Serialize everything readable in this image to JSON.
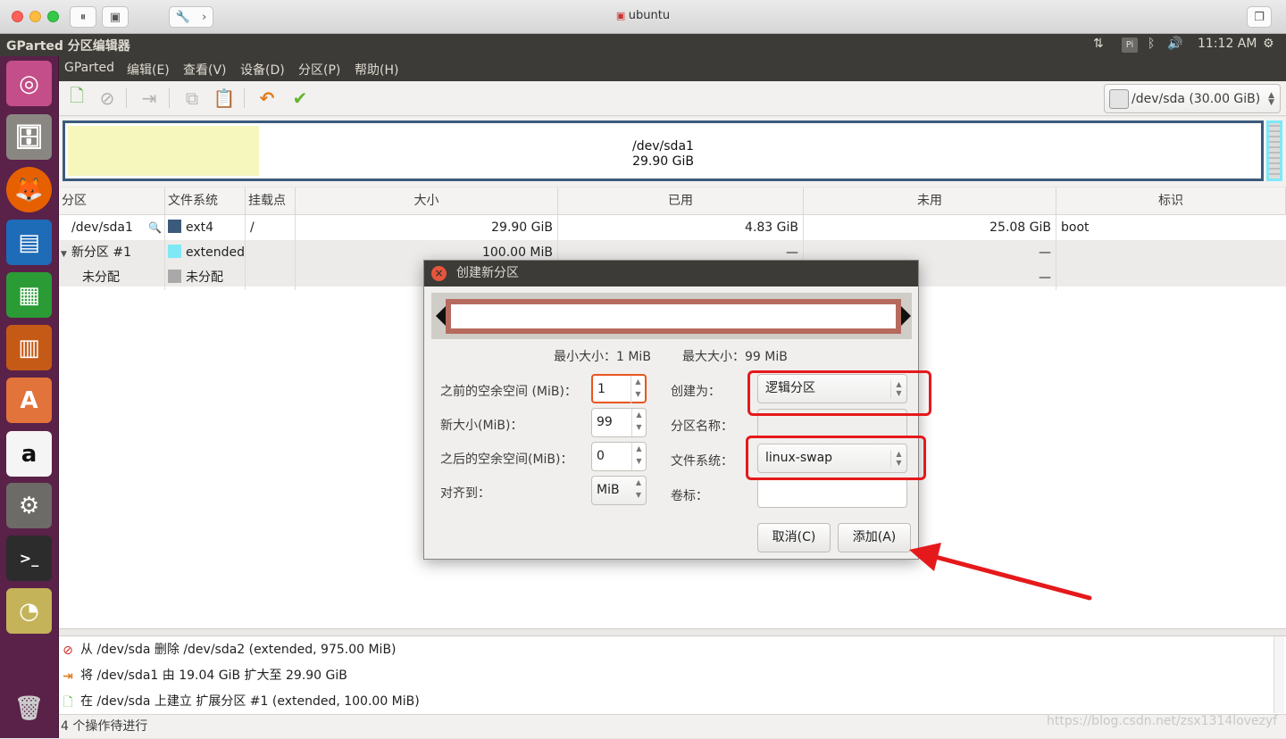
{
  "host_window": {
    "title": "ubuntu"
  },
  "top_panel": {
    "app_title": "GParted 分区编辑器",
    "time": "11:12 AM",
    "input_method": "Pi"
  },
  "menu": [
    "GParted",
    "编辑(E)",
    "查看(V)",
    "设备(D)",
    "分区(P)",
    "帮助(H)"
  ],
  "device": {
    "selected": "/dev/sda  (30.00 GiB)"
  },
  "disk_visual": {
    "name": "/dev/sda1",
    "size": "29.90 GiB",
    "used_fraction": 0.16
  },
  "table": {
    "columns": [
      "分区",
      "文件系统",
      "挂载点",
      "大小",
      "已用",
      "未用",
      "标识"
    ],
    "rows": [
      {
        "partition": "/dev/sda1",
        "fs": "ext4",
        "fs_color": "#3c5a7c",
        "mount": "/",
        "size": "29.90 GiB",
        "used": "4.83 GiB",
        "unused": "25.08 GiB",
        "flags": "boot"
      },
      {
        "partition": "新分区 #1",
        "fs": "extended",
        "fs_color": "#7fe8f5",
        "mount": "",
        "size": "100.00 MiB",
        "used": "—",
        "unused": "—",
        "flags": ""
      },
      {
        "partition": "未分配",
        "fs": "未分配",
        "fs_color": "#a9a9a9",
        "mount": "",
        "size": "",
        "used": "",
        "unused": "—",
        "flags": ""
      }
    ]
  },
  "operations": [
    {
      "icon": "delete-icon",
      "text": "从 /dev/sda 删除 /dev/sda2 (extended, 975.00 MiB)"
    },
    {
      "icon": "resize-icon",
      "text": "将 /dev/sda1 由 19.04 GiB 扩大至 29.90 GiB"
    },
    {
      "icon": "new-icon",
      "text": "在 /dev/sda 上建立 扩展分区 #1 (extended, 100.00 MiB)"
    }
  ],
  "status": "4 个操作待进行",
  "watermark": "https://blog.csdn.net/zsx1314lovezyf",
  "dialog": {
    "title": "创建新分区",
    "min_size": "最小大小：1 MiB",
    "max_size": "最大大小：99 MiB",
    "free_before_label": "之前的空余空间 (MiB)：",
    "free_before_value": "1",
    "new_size_label": "新大小(MiB)：",
    "new_size_value": "99",
    "free_after_label": "之后的空余空间(MiB)：",
    "free_after_value": "0",
    "align_label": "对齐到：",
    "align_value": "MiB",
    "create_as_label": "创建为：",
    "create_as_value": "逻辑分区",
    "partition_name_label": "分区名称：",
    "filesystem_label": "文件系统：",
    "filesystem_value": "linux-swap",
    "volume_label_label": "卷标：",
    "cancel_button": "取消(C)",
    "add_button": "添加(A)"
  }
}
